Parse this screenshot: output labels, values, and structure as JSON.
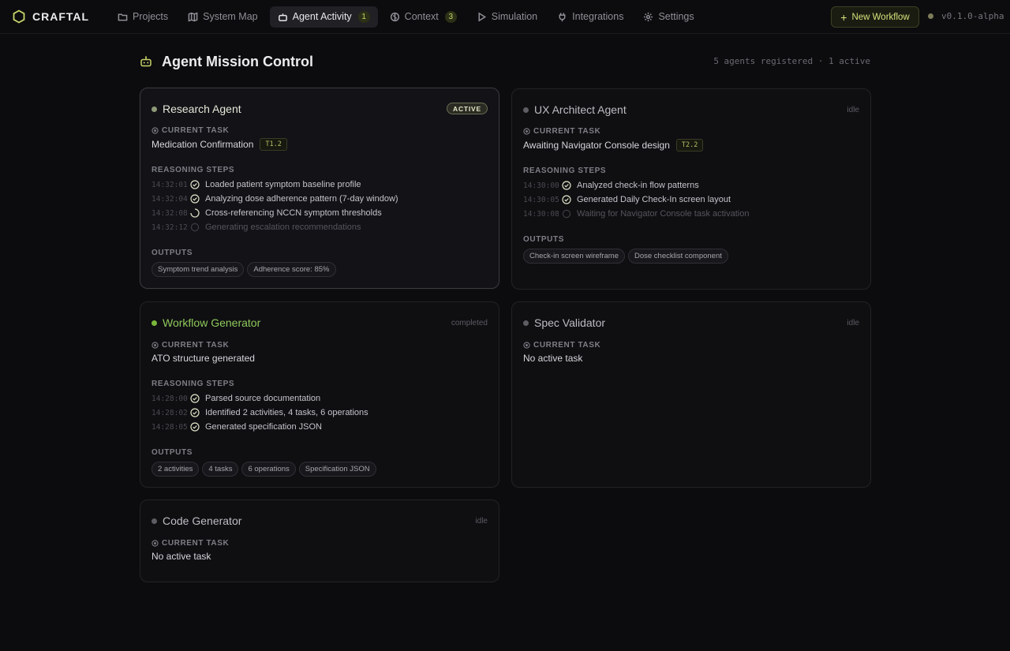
{
  "brand": {
    "name": "CRAFTAL",
    "icon": "hexagon-logo-icon",
    "accent": "#c9d46a"
  },
  "nav": [
    {
      "label": "Projects",
      "icon": "folder-icon",
      "active": false
    },
    {
      "label": "System Map",
      "icon": "map-icon",
      "active": false
    },
    {
      "label": "Agent Activity",
      "icon": "bot-icon",
      "active": true,
      "badge": "1"
    },
    {
      "label": "Context",
      "icon": "brain-icon",
      "active": false,
      "badge": "3"
    },
    {
      "label": "Simulation",
      "icon": "play-icon",
      "active": false
    },
    {
      "label": "Integrations",
      "icon": "plug-icon",
      "active": false
    },
    {
      "label": "Settings",
      "icon": "gear-icon",
      "active": false
    }
  ],
  "toolbar": {
    "new_workflow_label": "New Workflow",
    "version": "v0.1.0-alpha"
  },
  "page": {
    "title": "Agent Mission Control",
    "meta": "5 agents registered · 1 active"
  },
  "labels": {
    "current_task": "CURRENT TASK",
    "reasoning_steps": "REASONING STEPS",
    "outputs": "OUTPUTS"
  },
  "agents": [
    {
      "name": "Research Agent",
      "status": "ACTIVE",
      "task": "Medication Confirmation",
      "task_tag": "T1.2",
      "steps": [
        {
          "time": "14:32:01",
          "text": "Loaded patient symptom baseline profile",
          "state": "done"
        },
        {
          "time": "14:32:04",
          "text": "Analyzing dose adherence pattern (7-day window)",
          "state": "done"
        },
        {
          "time": "14:32:08",
          "text": "Cross-referencing NCCN symptom thresholds",
          "state": "running"
        },
        {
          "time": "14:32:12",
          "text": "Generating escalation recommendations",
          "state": "pending"
        }
      ],
      "outputs": [
        "Symptom trend analysis",
        "Adherence score: 85%"
      ]
    },
    {
      "name": "UX Architect Agent",
      "status": "idle",
      "task": "Awaiting Navigator Console design",
      "task_tag": "T2.2",
      "steps": [
        {
          "time": "14:30:00",
          "text": "Analyzed check-in flow patterns",
          "state": "done"
        },
        {
          "time": "14:30:05",
          "text": "Generated Daily Check-In screen layout",
          "state": "done"
        },
        {
          "time": "14:30:08",
          "text": "Waiting for Navigator Console task activation",
          "state": "pending"
        }
      ],
      "outputs": [
        "Check-in screen wireframe",
        "Dose checklist component"
      ]
    },
    {
      "name": "Workflow Generator",
      "status": "completed",
      "task": "ATO structure generated",
      "steps": [
        {
          "time": "14:28:00",
          "text": "Parsed source documentation",
          "state": "done"
        },
        {
          "time": "14:28:02",
          "text": "Identified 2 activities, 4 tasks, 6 operations",
          "state": "done"
        },
        {
          "time": "14:28:05",
          "text": "Generated specification JSON",
          "state": "done"
        }
      ],
      "outputs": [
        "2 activities",
        "4 tasks",
        "6 operations",
        "Specification JSON"
      ]
    },
    {
      "name": "Spec Validator",
      "status": "idle",
      "task": "No active task"
    },
    {
      "name": "Code Generator",
      "status": "idle",
      "task": "No active task"
    }
  ]
}
